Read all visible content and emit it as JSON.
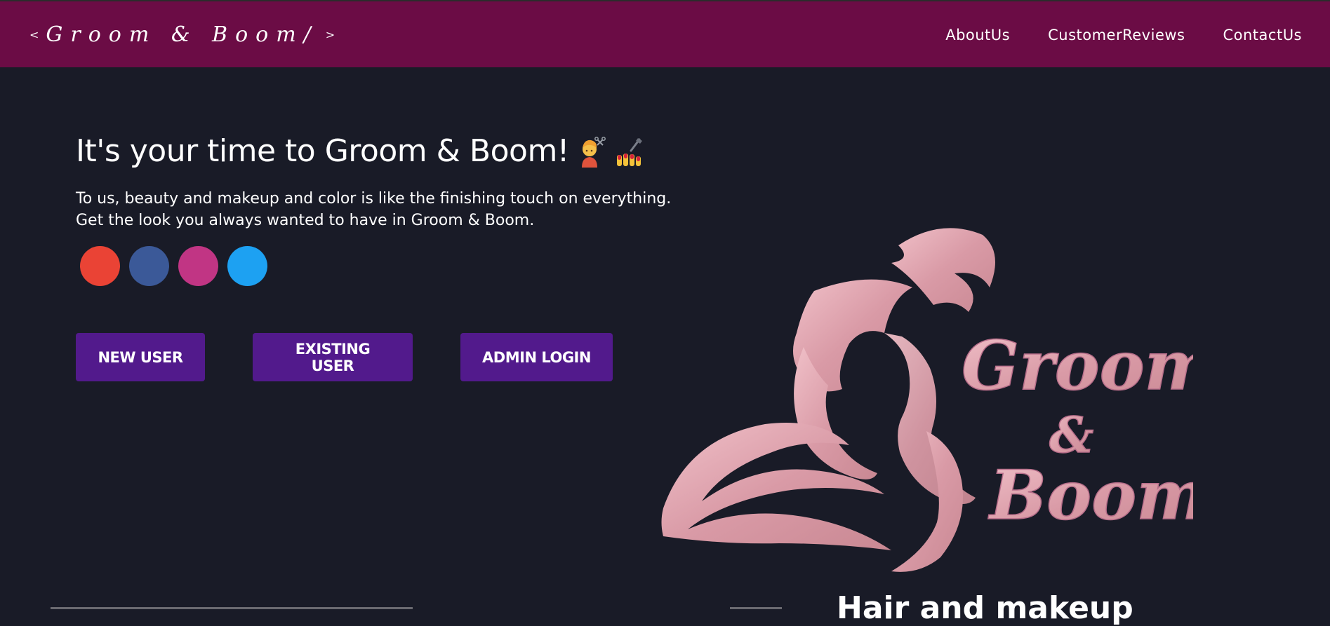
{
  "navbar": {
    "brand": {
      "left_bracket": "<",
      "text": "Groom & Boom/",
      "right_bracket": ">"
    },
    "links": [
      "AboutUs",
      "CustomerReviews",
      "ContactUs"
    ]
  },
  "hero": {
    "title": "It's your time to Groom & Boom!",
    "title_emojis": [
      "haircut-person-icon",
      "nail-polish-icon"
    ],
    "description_line1": "To us, beauty and makeup and color is like the finishing touch on everything.",
    "description_line2": "Get the look you always wanted to have in Groom & Boom."
  },
  "socials": [
    {
      "name": "google-icon",
      "color": "#ea4335"
    },
    {
      "name": "facebook-icon",
      "color": "#3b5998"
    },
    {
      "name": "instagram-icon",
      "color": "#c13584"
    },
    {
      "name": "twitter-icon",
      "color": "#1da1f2"
    }
  ],
  "buttons": {
    "new_user": "NEW USER",
    "existing_user": "EXISTING USER",
    "admin_login": "ADMIN LOGIN"
  },
  "logo": {
    "text_line1": "Groom",
    "text_line2": "&",
    "text_line3": "Boom",
    "color": "#e8a8b4",
    "caption": "Hair and makeup"
  },
  "colors": {
    "navbar": "#6b0c45",
    "background": "#191b27",
    "button": "#521a8c"
  }
}
